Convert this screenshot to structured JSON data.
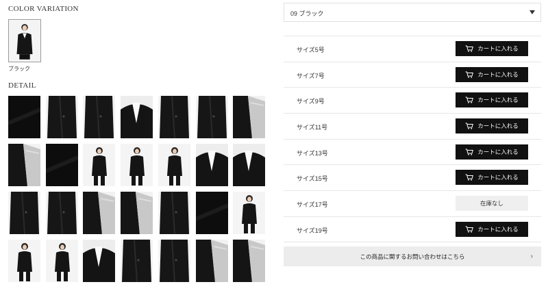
{
  "color_variation": {
    "heading": "COLOR VARIATION",
    "swatches": [
      {
        "label": "ブラック"
      }
    ]
  },
  "detail": {
    "heading": "DETAIL",
    "thumbnails": [
      {
        "icon": "fabric-closeup-black"
      },
      {
        "icon": "jacket-back-view"
      },
      {
        "icon": "jacket-side-view"
      },
      {
        "icon": "jacket-front-collar"
      },
      {
        "icon": "jacket-pocket-detail"
      },
      {
        "icon": "jacket-hem-detail"
      },
      {
        "icon": "jacket-lining-open"
      },
      {
        "icon": "jacket-lining-inside"
      },
      {
        "icon": "fabric-pinstripe-black"
      },
      {
        "icon": "model-pants-full"
      },
      {
        "icon": "model-back-full"
      },
      {
        "icon": "model-side-full"
      },
      {
        "icon": "model-collar-closeup"
      },
      {
        "icon": "lapel-closeup"
      },
      {
        "icon": "sleeve-cuff-detail"
      },
      {
        "icon": "jacket-back-hem"
      },
      {
        "icon": "lining-grey-detail"
      },
      {
        "icon": "lining-open-side"
      },
      {
        "icon": "jacket-buttons-front"
      },
      {
        "icon": "fabric-closeup-dark"
      },
      {
        "icon": "model-skirt-full"
      },
      {
        "icon": "model-skirt-back"
      },
      {
        "icon": "model-skirt-side"
      },
      {
        "icon": "model-shirt-collar"
      },
      {
        "icon": "jacket-waist-detail"
      },
      {
        "icon": "jacket-skirt-front"
      },
      {
        "icon": "lining-left-detail"
      },
      {
        "icon": "lining-right-detail"
      }
    ]
  },
  "color_select": {
    "value": "09 ブラック"
  },
  "sizes": [
    {
      "label": "サイズ5号",
      "action": "カートに入れる",
      "available": true
    },
    {
      "label": "サイズ7号",
      "action": "カートに入れる",
      "available": true
    },
    {
      "label": "サイズ9号",
      "action": "カートに入れる",
      "available": true
    },
    {
      "label": "サイズ11号",
      "action": "カートに入れる",
      "available": true
    },
    {
      "label": "サイズ13号",
      "action": "カートに入れる",
      "available": true
    },
    {
      "label": "サイズ15号",
      "action": "カートに入れる",
      "available": true
    },
    {
      "label": "サイズ17号",
      "action": "在庫なし",
      "available": false
    },
    {
      "label": "サイズ19号",
      "action": "カートに入れる",
      "available": true
    }
  ],
  "inquiry": {
    "label": "この商品に関するお問い合わせはこちら"
  },
  "colors": {
    "button_bg": "#111111",
    "soldout_bg": "#efefef",
    "inquiry_bg": "#ececec"
  }
}
